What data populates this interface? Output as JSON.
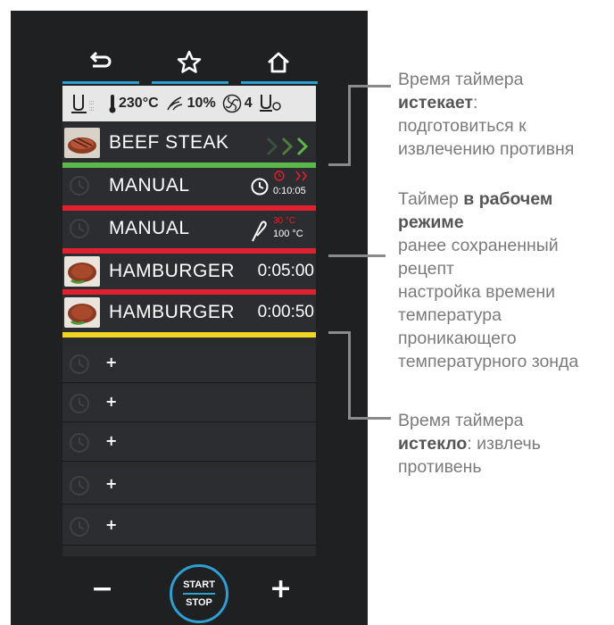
{
  "nav": {
    "back_icon": "back-arrow-icon",
    "favorite_icon": "star-icon",
    "home_icon": "home-icon"
  },
  "status": {
    "temperature": "230°C",
    "humidity": "10%",
    "fan_speed": "4"
  },
  "programs": [
    {
      "name": "BEEF STEAK",
      "time": "",
      "bar_color": "#5cb84a",
      "image": "steak"
    },
    {
      "name": "MANUAL",
      "timer_elapsed": "0:10:05",
      "bar_color": "#e0202e",
      "image": ""
    },
    {
      "name": "MANUAL",
      "probe_set": "30 °C",
      "probe_actual": "100 °C",
      "bar_color": "#e0202e",
      "image": ""
    },
    {
      "name": "HAMBURGER",
      "time": "0:05:00",
      "bar_color": "#e0202e",
      "image": "burger"
    },
    {
      "name": "HAMBURGER",
      "time": "0:00:50",
      "bar_color": "#f2d722",
      "image": "burger"
    }
  ],
  "empty_slots": [
    "+",
    "+",
    "+",
    "+",
    "+"
  ],
  "controls": {
    "minus": "−",
    "plus": "+",
    "start": "START",
    "stop": "STOP"
  },
  "annotations": {
    "a1_line1": "Время таймера",
    "a1_bold": "истекает",
    "a1_rest": ":",
    "a1_line3": "подготовиться к",
    "a1_line4": "извлечению противня",
    "a2_line1": "Таймер ",
    "a2_bold1": "в рабочем",
    "a2_bold2": "режиме",
    "a2_l3": "ранее сохраненный",
    "a2_l4": "рецепт",
    "a2_l5": "настройка времени",
    "a2_l6": "температура",
    "a2_l7": "проникающего",
    "a2_l8": "температурного зонда",
    "a3_line1": "Время таймера",
    "a3_bold": "истекло",
    "a3_rest": ": извлечь",
    "a3_line3": "противень"
  },
  "colors": {
    "accent": "#2d9fd0",
    "green": "#5cb84a",
    "red": "#e0202e",
    "yellow": "#f2d722"
  }
}
